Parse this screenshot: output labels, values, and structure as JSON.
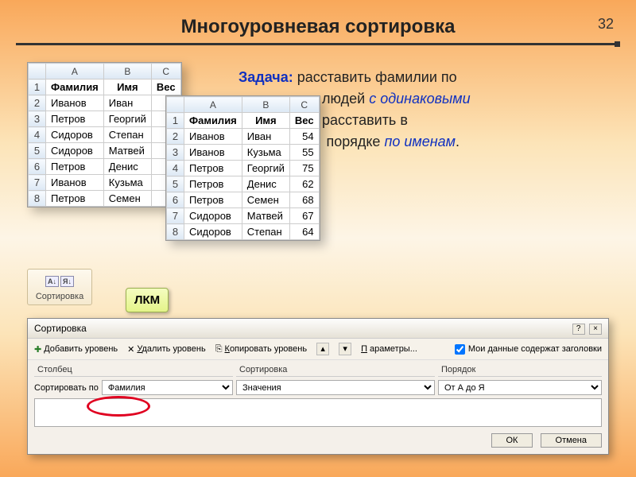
{
  "page_number": "32",
  "title": "Многоуровневая сортировка",
  "task": {
    "keyword": "Задача:",
    "p1": " расставить фамилии по",
    "p2": "людей ",
    "p2em": "с одинаковыми",
    "p3": "расставить в",
    "p4": "порядке ",
    "p4em": "по именам",
    "p4end": "."
  },
  "sheet1": {
    "cols": [
      "A",
      "B",
      "C"
    ],
    "header": [
      "Фамилия",
      "Имя",
      "Вес"
    ],
    "rows": [
      [
        "2",
        "Иванов",
        "Иван",
        ""
      ],
      [
        "3",
        "Петров",
        "Георгий",
        ""
      ],
      [
        "4",
        "Сидоров",
        "Степан",
        ""
      ],
      [
        "5",
        "Сидоров",
        "Матвей",
        ""
      ],
      [
        "6",
        "Петров",
        "Денис",
        ""
      ],
      [
        "7",
        "Иванов",
        "Кузьма",
        ""
      ],
      [
        "8",
        "Петров",
        "Семен",
        ""
      ]
    ]
  },
  "sheet2": {
    "cols": [
      "A",
      "B",
      "C"
    ],
    "header": [
      "Фамилия",
      "Имя",
      "Вес"
    ],
    "rows": [
      [
        "2",
        "Иванов",
        "Иван",
        "54"
      ],
      [
        "3",
        "Иванов",
        "Кузьма",
        "55"
      ],
      [
        "4",
        "Петров",
        "Георгий",
        "75"
      ],
      [
        "5",
        "Петров",
        "Денис",
        "62"
      ],
      [
        "6",
        "Петров",
        "Семен",
        "68"
      ],
      [
        "7",
        "Сидоров",
        "Матвей",
        "67"
      ],
      [
        "8",
        "Сидоров",
        "Степан",
        "64"
      ]
    ]
  },
  "sort_button_label": "Сортировка",
  "lkm": "ЛКМ",
  "dialog": {
    "title": "Сортировка",
    "add": "Добавить уровень",
    "del": "Удалить уровень",
    "copy": "Копировать уровень",
    "params": "Параметры...",
    "headers_chk": "Мои данные содержат заголовки",
    "col_hdr": "Столбец",
    "sort_hdr": "Сортировка",
    "order_hdr": "Порядок",
    "sort_by": "Сортировать по",
    "field": "Фамилия",
    "sort_on": "Значения",
    "order": "От А до Я",
    "ok": "ОК",
    "cancel": "Отмена"
  }
}
